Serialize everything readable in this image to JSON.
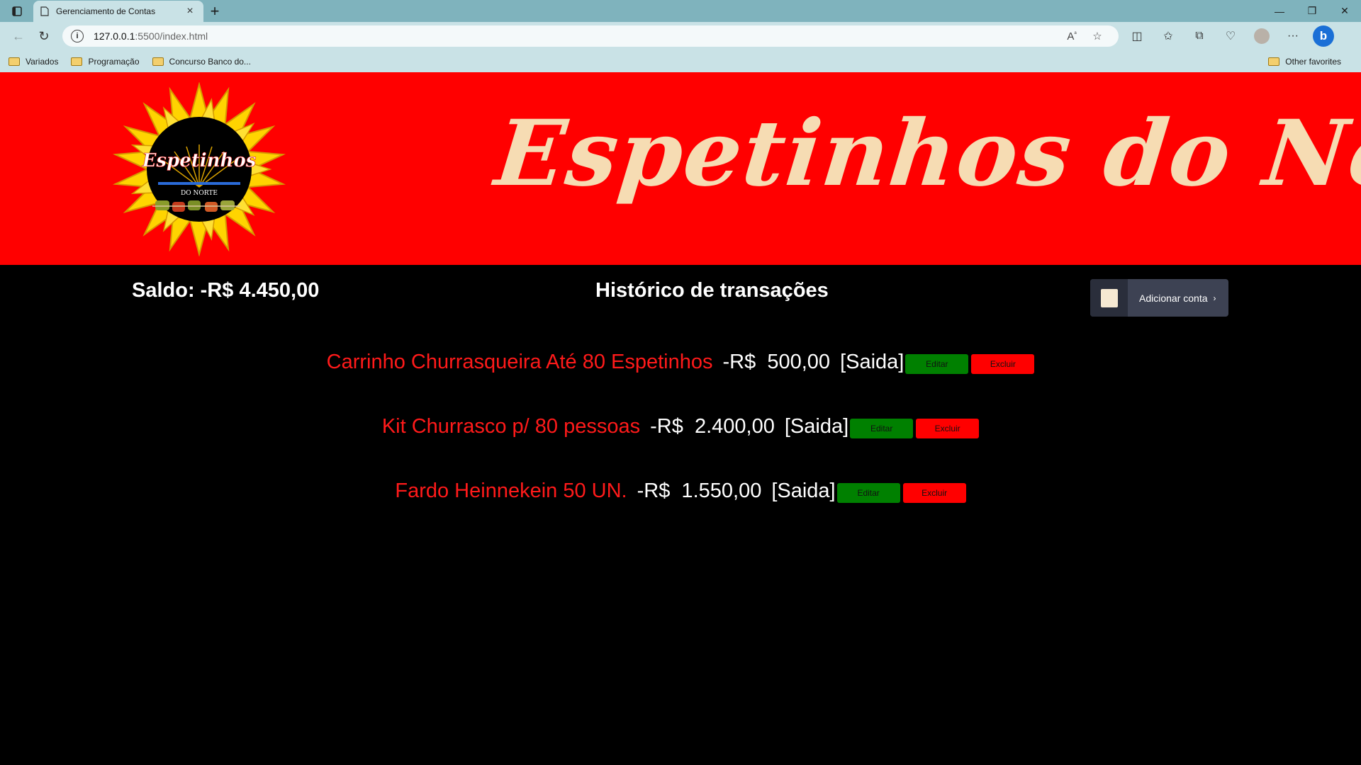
{
  "browser": {
    "tab_title": "Gerenciamento de Contas",
    "url_host": "127.0.0.1",
    "url_path": ":5500/index.html",
    "favorites": [
      "Variados",
      "Programação",
      "Concurso Banco do..."
    ],
    "other_favorites": "Other favorites"
  },
  "header": {
    "logo_text": "Espetinhos",
    "logo_subtext": "DO NORTE",
    "brand_title": "Espetinhos do Norte"
  },
  "summary": {
    "saldo": "Saldo: -R$ 4.450,00",
    "history_title": "Histórico de transações",
    "add_button_label": "Adicionar conta"
  },
  "transactions": [
    {
      "name": "Carrinho Churrasqueira Até 80 Espetinhos",
      "amount": "-R$  500,00",
      "kind": "[Saida]",
      "edit": "Editar",
      "delete": "Excluir"
    },
    {
      "name": "Kit Churrasco p/ 80 pessoas",
      "amount": "-R$  2.400,00",
      "kind": "[Saida]",
      "edit": "Editar",
      "delete": "Excluir"
    },
    {
      "name": "Fardo Heinnekein 50 UN.",
      "amount": "-R$  1.550,00",
      "kind": "[Saida]",
      "edit": "Editar",
      "delete": "Excluir"
    }
  ],
  "colors": {
    "banner": "#ff0000",
    "brand_text": "#f6dcb3",
    "edit_button": "#008000",
    "delete_button": "#ff0000",
    "transaction_name": "#ff1a1a"
  }
}
